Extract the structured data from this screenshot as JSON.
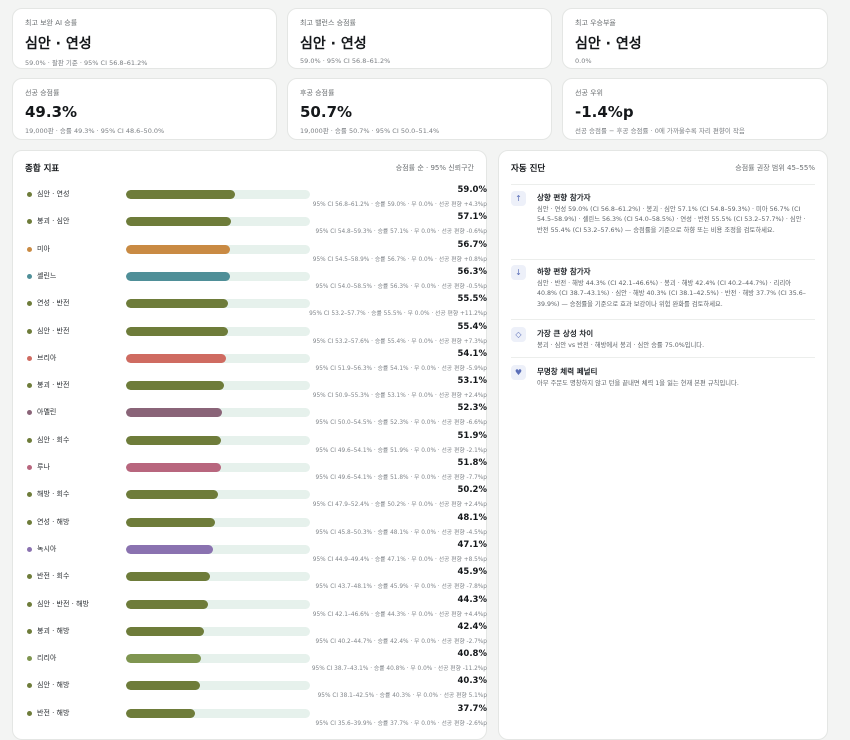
{
  "kpis_top": [
    {
      "label": "최고 보완 AI 승률",
      "value": "심안 · 연성",
      "sub": "59.0% · 팔판 기준 · 95% CI 56.8–61.2%"
    },
    {
      "label": "최고 밸런스 승점률",
      "value": "심안 · 연성",
      "sub": "59.0% · 95% CI 56.8–61.2%"
    },
    {
      "label": "최고 우승부율",
      "value": "심안 · 연성",
      "sub": "0.0%"
    }
  ],
  "kpis_bottom": [
    {
      "label": "선공 승점률",
      "value": "49.3%",
      "sub": "19,000판 · 승률 49.3% · 95% CI 48.6–50.0%"
    },
    {
      "label": "후공 승점률",
      "value": "50.7%",
      "sub": "19,000판 · 승률 50.7% · 95% CI 50.0–51.4%"
    },
    {
      "label": "선공 우위",
      "value": "-1.4%p",
      "sub": "선공 승점률 − 후공 승점률 · 0에 가까울수록 자리 편향이 작음"
    }
  ],
  "summary": {
    "title": "종합 지표",
    "note": "승점률 순 · 95% 신뢰구간",
    "rows": [
      {
        "name": "심안 · 연성",
        "value": "59.0%",
        "pct": 59.0,
        "sub": "95% CI 56.8–61.2% · 승률 59.0% · 무 0.0% · 선공 편향 +4.3%p",
        "color": "#6e7c3a"
      },
      {
        "name": "봉괴 · 심안",
        "value": "57.1%",
        "pct": 57.1,
        "sub": "95% CI 54.8–59.3% · 승률 57.1% · 무 0.0% · 선공 편향 -0.6%p",
        "color": "#6e7c3a"
      },
      {
        "name": "미아",
        "value": "56.7%",
        "pct": 56.7,
        "sub": "95% CI 54.5–58.9% · 승률 56.7% · 무 0.0% · 선공 편향 +0.8%p",
        "color": "#c98a43"
      },
      {
        "name": "셸린느",
        "value": "56.3%",
        "pct": 56.3,
        "sub": "95% CI 54.0–58.5% · 승률 56.3% · 무 0.0% · 선공 편향 -0.5%p",
        "color": "#4f8f98"
      },
      {
        "name": "연성 · 반전",
        "value": "55.5%",
        "pct": 55.5,
        "sub": "95% CI 53.2–57.7% · 승률 55.5% · 무 0.0% · 선공 편향 +11.2%p",
        "color": "#6e7c3a"
      },
      {
        "name": "심안 · 반전",
        "value": "55.4%",
        "pct": 55.4,
        "sub": "95% CI 53.2–57.6% · 승률 55.4% · 무 0.0% · 선공 편향 +7.3%p",
        "color": "#6e7c3a"
      },
      {
        "name": "브리아",
        "value": "54.1%",
        "pct": 54.1,
        "sub": "95% CI 51.9–56.3% · 승률 54.1% · 무 0.0% · 선공 편향 -5.9%p",
        "color": "#cf6b61"
      },
      {
        "name": "봉괴 · 반전",
        "value": "53.1%",
        "pct": 53.1,
        "sub": "95% CI 50.9–55.3% · 승률 53.1% · 무 0.0% · 선공 편향 +2.4%p",
        "color": "#6e7c3a"
      },
      {
        "name": "아멜린",
        "value": "52.3%",
        "pct": 52.3,
        "sub": "95% CI 50.0–54.5% · 승률 52.3% · 무 0.0% · 선공 편향 -6.6%p",
        "color": "#8a6478"
      },
      {
        "name": "심안 · 회수",
        "value": "51.9%",
        "pct": 51.9,
        "sub": "95% CI 49.6–54.1% · 승률 51.9% · 무 0.0% · 선공 편향 -2.1%p",
        "color": "#6e7c3a"
      },
      {
        "name": "루나",
        "value": "51.8%",
        "pct": 51.8,
        "sub": "95% CI 49.6–54.1% · 승률 51.8% · 무 0.0% · 선공 편향 -7.7%p",
        "color": "#b8667e"
      },
      {
        "name": "해방 · 회수",
        "value": "50.2%",
        "pct": 50.2,
        "sub": "95% CI 47.9–52.4% · 승률 50.2% · 무 0.0% · 선공 편향 +2.4%p",
        "color": "#6e7c3a"
      },
      {
        "name": "연성 · 해방",
        "value": "48.1%",
        "pct": 48.1,
        "sub": "95% CI 45.8–50.3% · 승률 48.1% · 무 0.0% · 선공 편향 -4.5%p",
        "color": "#6e7c3a"
      },
      {
        "name": "녹시아",
        "value": "47.1%",
        "pct": 47.1,
        "sub": "95% CI 44.9–49.4% · 승률 47.1% · 무 0.0% · 선공 편향 +8.5%p",
        "color": "#8a72b0"
      },
      {
        "name": "반전 · 회수",
        "value": "45.9%",
        "pct": 45.9,
        "sub": "95% CI 43.7–48.1% · 승률 45.9% · 무 0.0% · 선공 편향 -7.8%p",
        "color": "#6e7c3a"
      },
      {
        "name": "심안 · 반전 · 해방",
        "value": "44.3%",
        "pct": 44.3,
        "sub": "95% CI 42.1–46.6% · 승률 44.3% · 무 0.0% · 선공 편향 +4.4%p",
        "color": "#6e7c3a"
      },
      {
        "name": "봉괴 · 해방",
        "value": "42.4%",
        "pct": 42.4,
        "sub": "95% CI 40.2–44.7% · 승률 42.4% · 무 0.0% · 선공 편향 -2.7%p",
        "color": "#6e7c3a"
      },
      {
        "name": "리리아",
        "value": "40.8%",
        "pct": 40.8,
        "sub": "95% CI 38.7–43.1% · 승률 40.8% · 무 0.0% · 선공 편향 -11.2%p",
        "color": "#7f9550"
      },
      {
        "name": "심안 · 해방",
        "value": "40.3%",
        "pct": 40.3,
        "sub": "95% CI 38.1–42.5% · 승률 40.3% · 무 0.0% · 선공 편향 5.1%p",
        "color": "#6e7c3a"
      },
      {
        "name": "반전 · 해방",
        "value": "37.7%",
        "pct": 37.7,
        "sub": "95% CI 35.6–39.9% · 승률 37.7% · 무 0.0% · 선공 편향 -2.6%p",
        "color": "#6e7c3a"
      }
    ]
  },
  "diagnosis": {
    "title": "자동 진단",
    "note": "승점률 권장 범위 45–55%",
    "items": [
      {
        "icon": "↑",
        "icon_name": "arrow-up-icon",
        "title": "상향 편향 참가자",
        "text": "심안 · 연성 59.0% (CI 56.8–61.2%) · 봉괴 · 심안 57.1% (CI 54.8–59.3%) · 미아 56.7% (CI 54.5–58.9%) · 셸린느 56.3% (CI 54.0–58.5%) · 연성 · 반전 55.5% (CI 53.2–57.7%) · 심안 · 반전 55.4% (CI 53.2–57.6%) — 승점률을 기준으로 하향 또는 비용 조정을 검토하세요."
      },
      {
        "icon": "↓",
        "icon_name": "arrow-down-icon",
        "title": "하향 편향 참가자",
        "text": "심안 · 반전 · 해방 44.3% (CI 42.1–46.6%) · 봉괴 · 해방 42.4% (CI 40.2–44.7%) · 리리아 40.8% (CI 38.7–43.1%) · 심안 · 해방 40.3% (CI 38.1–42.5%) · 반전 · 해방 37.7% (CI 35.6–39.9%) — 승점률을 기준으로 효과 보강이나 위험 완화를 검토하세요."
      },
      {
        "icon": "◇",
        "icon_name": "diamond-icon",
        "title": "가장 큰 상성 차이",
        "text": "봉괴 · 심안 vs 반전 · 해방에서 봉괴 · 심안 승률 75.0%입니다."
      },
      {
        "icon": "♥",
        "icon_name": "heart-icon",
        "title": "무명창 체력 페널티",
        "text": "아무 주문도 명창하지 않고 턴을 끝내면 체력 1을 잃는 현재 본편 규칙입니다."
      }
    ]
  }
}
